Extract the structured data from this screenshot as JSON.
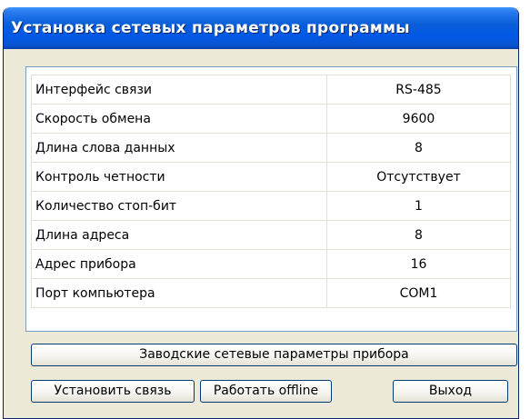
{
  "window": {
    "title": "Установка сетевых параметров программы"
  },
  "params": [
    {
      "name": "Интерфейс связи",
      "value": "RS-485"
    },
    {
      "name": "Скорость обмена",
      "value": "9600"
    },
    {
      "name": "Длина слова данных",
      "value": "8"
    },
    {
      "name": "Контроль четности",
      "value": "Отсутствует"
    },
    {
      "name": "Количество стоп-бит",
      "value": "1"
    },
    {
      "name": "Длина адреса",
      "value": "8"
    },
    {
      "name": "Адрес прибора",
      "value": "16"
    },
    {
      "name": "Порт компьютера",
      "value": "COM1"
    }
  ],
  "buttons": {
    "factory_defaults": "Заводские сетевые параметры прибора",
    "connect": "Установить связь",
    "offline": "Работать offline",
    "exit": "Выход"
  },
  "colors": {
    "titlebar": "#0058e6",
    "title_text": "#ffffff",
    "window_bg": "#ece9d8",
    "panel_border": "#7f9db9",
    "button_border": "#003c74",
    "grid_line": "#e2e0d6"
  }
}
